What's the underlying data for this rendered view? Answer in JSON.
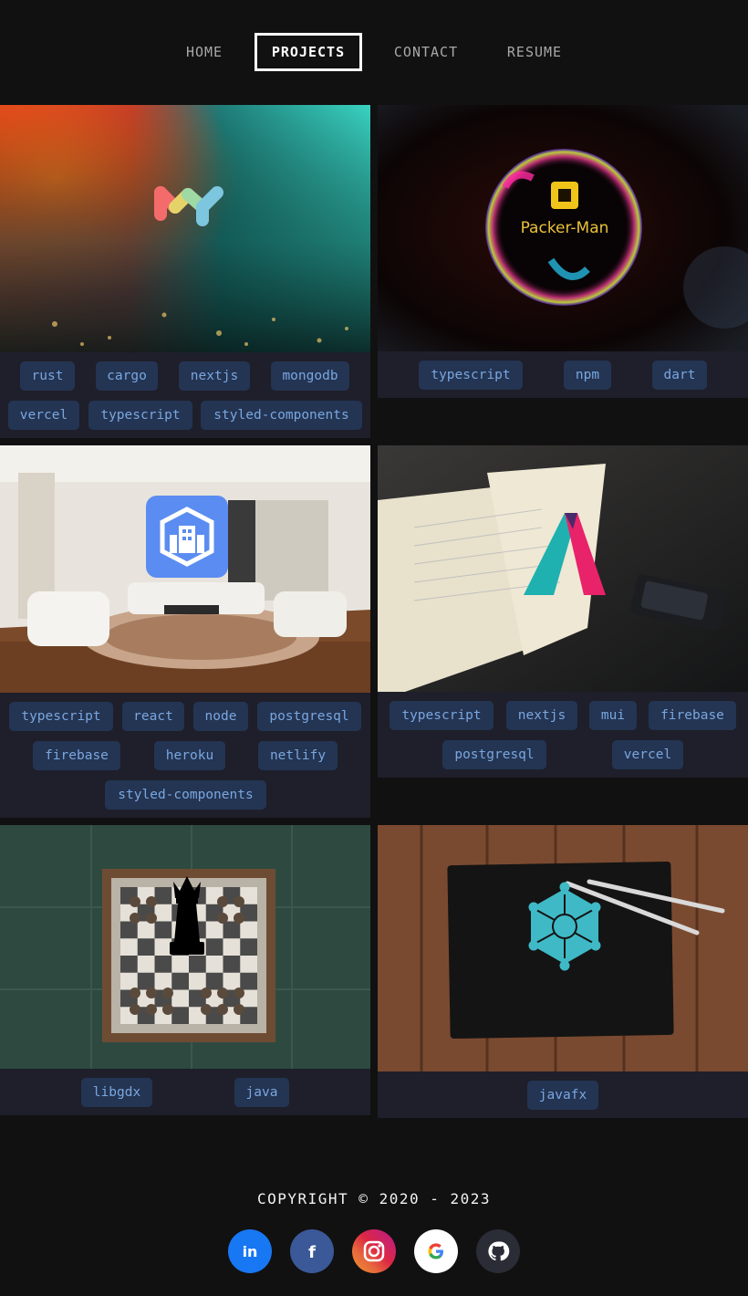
{
  "nav": {
    "items": [
      {
        "label": "HOME"
      },
      {
        "label": "PROJECTS"
      },
      {
        "label": "CONTACT"
      },
      {
        "label": "RESUME"
      }
    ],
    "active": "PROJECTS"
  },
  "projects": [
    {
      "image": "colorful-paint-abstract-with-molecule-logo",
      "tags": [
        "rust",
        "cargo",
        "nextjs",
        "mongodb",
        "vercel",
        "typescript",
        "styled-components"
      ]
    },
    {
      "image": "soap-bubble-logo",
      "logo_text": "Packer-Man",
      "tags": [
        "typescript",
        "npm",
        "dart"
      ]
    },
    {
      "image": "living-room-with-building-app-icon",
      "tags": [
        "typescript",
        "react",
        "node",
        "postgresql",
        "firebase",
        "heroku",
        "netlify",
        "styled-components"
      ]
    },
    {
      "image": "open-notebook-with-letter-a-logo",
      "tags": [
        "typescript",
        "nextjs",
        "mui",
        "firebase",
        "postgresql",
        "vercel"
      ]
    },
    {
      "image": "chessboard-with-queen-icon",
      "tags": [
        "libgdx",
        "java"
      ]
    },
    {
      "image": "wood-desk-with-molecule-icon-and-pencils",
      "tags": [
        "javafx"
      ]
    }
  ],
  "footer": {
    "copyright": "COPYRIGHT © 2020 - 2023",
    "social": [
      {
        "name": "linkedin-icon",
        "label": "in",
        "color": "#1877f2"
      },
      {
        "name": "facebook-icon",
        "label": "f",
        "color": "#3b5998"
      },
      {
        "name": "instagram-icon",
        "color": "#dc2743"
      },
      {
        "name": "google-icon",
        "color": "#ffffff"
      },
      {
        "name": "github-icon",
        "color": "#2a2c36"
      }
    ]
  },
  "colors": {
    "background": "#111111",
    "card": "#1e1f2a",
    "tag_bg": "#243453",
    "tag_text": "#79a7df"
  }
}
